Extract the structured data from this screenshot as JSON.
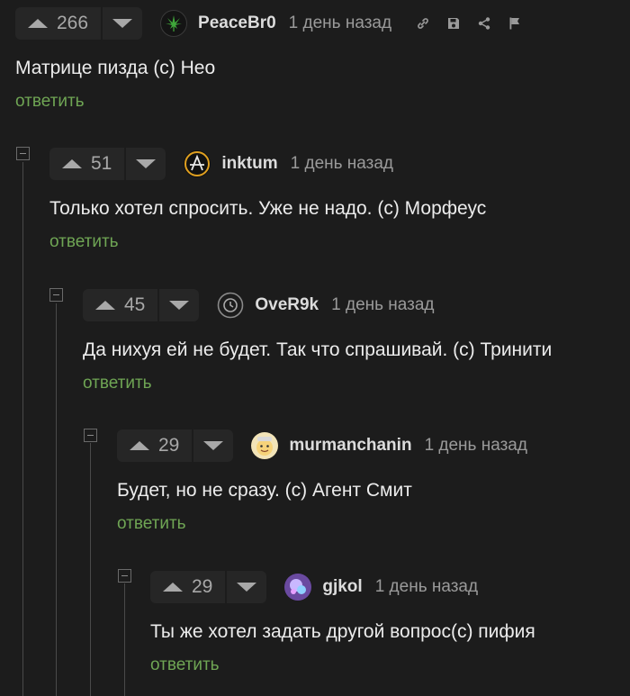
{
  "comments": [
    {
      "score": "266",
      "user": "PeaceBr0",
      "time": "1 день назад",
      "text": "Матрице пизда (с) Нео",
      "reply": "ответить"
    },
    {
      "score": "51",
      "user": "inktum",
      "time": "1 день назад",
      "text": "Только хотел спросить. Уже не надо. (с) Морфеус",
      "reply": "ответить"
    },
    {
      "score": "45",
      "user": "OveR9k",
      "time": "1 день назад",
      "text": "Да нихуя ей не будет. Так что спрашивай. (с) Тринити",
      "reply": "ответить"
    },
    {
      "score": "29",
      "user": "murmanchanin",
      "time": "1 день назад",
      "text": "Будет, но не сразу. (с) Агент Смит",
      "reply": "ответить"
    },
    {
      "score": "29",
      "user": "gjkol",
      "time": "1 день назад",
      "text": "Ты же хотел задать другой вопрос(с) пифия",
      "reply": "ответить"
    }
  ],
  "icons": {
    "avatars": [
      "cannabis-leaf-avatar",
      "anarchy-avatar",
      "clock-avatar",
      "cartoon-face-avatar",
      "purple-avatar"
    ],
    "actions": [
      "link-icon",
      "save-icon",
      "share-icon",
      "flag-icon"
    ]
  },
  "colors": {
    "background": "#1c1c1c",
    "reply": "#6fa554",
    "panel": "#262626"
  }
}
